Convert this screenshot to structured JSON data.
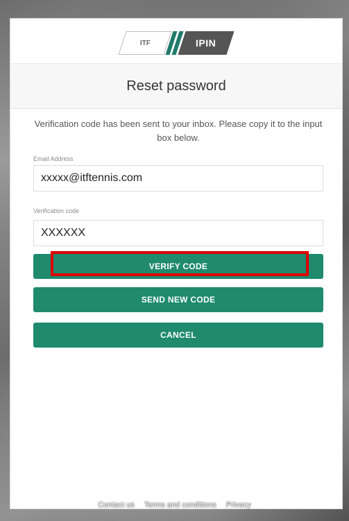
{
  "logo": {
    "left_text": "ITF",
    "right_text": "IPIN"
  },
  "page": {
    "title": "Reset password"
  },
  "info": {
    "message": "Verification code has been sent to your inbox. Please copy it to the input box below."
  },
  "form": {
    "email_label": "Email Address",
    "email_value": "xxxxx@itftennis.com",
    "code_label": "Verification code",
    "code_value": "XXXXXX"
  },
  "buttons": {
    "verify": "VERIFY CODE",
    "send_new": "SEND NEW CODE",
    "cancel": "CANCEL"
  },
  "footer": {
    "links": [
      "Contact us",
      "Terms and conditions",
      "Privacy"
    ]
  },
  "colors": {
    "accent": "#1f8a6e",
    "highlight": "#e00000"
  }
}
